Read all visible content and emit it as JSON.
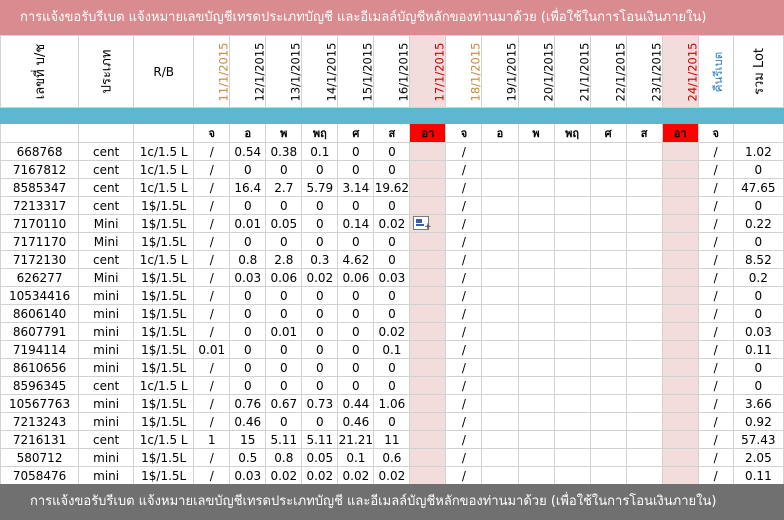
{
  "banner_top": "การแจ้งขอรับรีเบต   แจ้งหมายเลขบัญชีเทรดประเภทบัญชี และอีเมลล์บัญชีหลักของท่านมาด้วย   (เพื่อใช้ในการโอนเงินภายใน)",
  "banner_bottom": "การแจ้งขอรับรีเบต   แจ้งหมายเลขบัญชีเทรดประเภทบัญชี และอีเมลล์บัญชีหลักของท่านมาด้วย   (เพื่อใช้ในการโอนเงินภายใน)",
  "headers": {
    "account": "เลขที่ บ/ช",
    "type": "ประเภท",
    "rb": "R/B",
    "dates": [
      "11/1/2015",
      "12/1/2015",
      "13/1/2015",
      "14/1/2015",
      "15/1/2015",
      "16/1/2015",
      "17/1/2015",
      "18/1/2015",
      "19/1/2015",
      "20/1/2015",
      "21/1/2015",
      "22/1/2015",
      "23/1/2015",
      "24/1/2015",
      "คืนรีเบต"
    ],
    "total": "รวม Lot"
  },
  "day_labels": [
    "จ",
    "อ",
    "พ",
    "พฤ",
    "ศ",
    "ส",
    "อา",
    "จ",
    "อ",
    "พ",
    "พฤ",
    "ศ",
    "ส",
    "อา",
    "จ"
  ],
  "colors": {
    "banner_top": "#d98b8f",
    "banner_bottom": "#707070",
    "band": "#5bb8cf",
    "weekend": "#ff0000",
    "weekend_bg": "#f3dcdc"
  },
  "paste_icon": "paste-options-icon",
  "rows": [
    {
      "acct": "668768",
      "type": "cent",
      "rb": "1c/1.5 L",
      "d": [
        "/",
        "0.54",
        "0.38",
        "0.1",
        "0",
        "0",
        "",
        "/",
        "",
        "",
        "",
        "",
        "",
        "",
        "/"
      ],
      "total": "1.02"
    },
    {
      "acct": "7167812",
      "type": "cent",
      "rb": "1c/1.5 L",
      "d": [
        "/",
        "0",
        "0",
        "0",
        "0",
        "0",
        "",
        "/",
        "",
        "",
        "",
        "",
        "",
        "",
        "/"
      ],
      "total": "0"
    },
    {
      "acct": "8585347",
      "type": "cent",
      "rb": "1c/1.5 L",
      "d": [
        "/",
        "16.4",
        "2.7",
        "5.79",
        "3.14",
        "19.62",
        "",
        "/",
        "",
        "",
        "",
        "",
        "",
        "",
        "/"
      ],
      "total": "47.65"
    },
    {
      "acct": "7213317",
      "type": "cent",
      "rb": "1$/1.5L",
      "d": [
        "/",
        "0",
        "0",
        "0",
        "0",
        "0",
        "",
        "/",
        "",
        "",
        "",
        "",
        "",
        "",
        "/"
      ],
      "total": "0"
    },
    {
      "acct": "7170110",
      "type": "Mini",
      "rb": "1$/1.5L",
      "d": [
        "/",
        "0.01",
        "0.05",
        "0",
        "0.14",
        "0.02",
        "",
        "/",
        "",
        "",
        "",
        "",
        "",
        "",
        "/"
      ],
      "total": "0.22"
    },
    {
      "acct": "7171170",
      "type": "Mini",
      "rb": "1$/1.5L",
      "d": [
        "/",
        "0",
        "0",
        "0",
        "0",
        "0",
        "",
        "/",
        "",
        "",
        "",
        "",
        "",
        "",
        "/"
      ],
      "total": "0"
    },
    {
      "acct": "7172130",
      "type": "cent",
      "rb": "1c/1.5 L",
      "d": [
        "/",
        "0.8",
        "2.8",
        "0.3",
        "4.62",
        "0",
        "",
        "/",
        "",
        "",
        "",
        "",
        "",
        "",
        "/"
      ],
      "total": "8.52"
    },
    {
      "acct": "626277",
      "type": "Mini",
      "rb": "1$/1.5L",
      "d": [
        "/",
        "0.03",
        "0.06",
        "0.02",
        "0.06",
        "0.03",
        "",
        "/",
        "",
        "",
        "",
        "",
        "",
        "",
        "/"
      ],
      "total": "0.2"
    },
    {
      "acct": "10534416",
      "type": "mini",
      "rb": "1$/1.5L",
      "d": [
        "/",
        "0",
        "0",
        "0",
        "0",
        "0",
        "",
        "/",
        "",
        "",
        "",
        "",
        "",
        "",
        "/"
      ],
      "total": "0"
    },
    {
      "acct": "8606140",
      "type": "mini",
      "rb": "1$/1.5L",
      "d": [
        "/",
        "0",
        "0",
        "0",
        "0",
        "0",
        "",
        "/",
        "",
        "",
        "",
        "",
        "",
        "",
        "/"
      ],
      "total": "0"
    },
    {
      "acct": "8607791",
      "type": "mini",
      "rb": "1$/1.5L",
      "d": [
        "/",
        "0",
        "0.01",
        "0",
        "0",
        "0.02",
        "",
        "/",
        "",
        "",
        "",
        "",
        "",
        "",
        "/"
      ],
      "total": "0.03"
    },
    {
      "acct": "7194114",
      "type": "mini",
      "rb": "1$/1.5L",
      "d": [
        "0.01",
        "0",
        "0",
        "0",
        "0",
        "0.1",
        "",
        "/",
        "",
        "",
        "",
        "",
        "",
        "",
        "/"
      ],
      "total": "0.11"
    },
    {
      "acct": "8610656",
      "type": "mini",
      "rb": "1$/1.5L",
      "d": [
        "/",
        "0",
        "0",
        "0",
        "0",
        "0",
        "",
        "/",
        "",
        "",
        "",
        "",
        "",
        "",
        "/"
      ],
      "total": "0"
    },
    {
      "acct": "8596345",
      "type": "cent",
      "rb": "1c/1.5 L",
      "d": [
        "/",
        "0",
        "0",
        "0",
        "0",
        "0",
        "",
        "/",
        "",
        "",
        "",
        "",
        "",
        "",
        "/"
      ],
      "total": "0"
    },
    {
      "acct": "10567763",
      "type": "mini",
      "rb": "1$/1.5L",
      "d": [
        "/",
        "0.76",
        "0.67",
        "0.73",
        "0.44",
        "1.06",
        "",
        "/",
        "",
        "",
        "",
        "",
        "",
        "",
        "/"
      ],
      "total": "3.66"
    },
    {
      "acct": "7213243",
      "type": "mini",
      "rb": "1$/1.5L",
      "d": [
        "/",
        "0.46",
        "0",
        "0",
        "0.46",
        "0",
        "",
        "/",
        "",
        "",
        "",
        "",
        "",
        "",
        "/"
      ],
      "total": "0.92"
    },
    {
      "acct": "7216131",
      "type": "cent",
      "rb": "1c/1.5 L",
      "d": [
        "1",
        "15",
        "5.11",
        "5.11",
        "21.21",
        "11",
        "",
        "/",
        "",
        "",
        "",
        "",
        "",
        "",
        "/"
      ],
      "total": "57.43"
    },
    {
      "acct": "580712",
      "type": "mini",
      "rb": "1$/1.5L",
      "d": [
        "/",
        "0.5",
        "0.8",
        "0.05",
        "0.1",
        "0.6",
        "",
        "/",
        "",
        "",
        "",
        "",
        "",
        "",
        "/"
      ],
      "total": "2.05"
    },
    {
      "acct": "7058476",
      "type": "mini",
      "rb": "1$/1.5L",
      "d": [
        "/",
        "0.03",
        "0.02",
        "0.02",
        "0.02",
        "0.02",
        "",
        "/",
        "",
        "",
        "",
        "",
        "",
        "",
        "/"
      ],
      "total": "0.11"
    }
  ]
}
